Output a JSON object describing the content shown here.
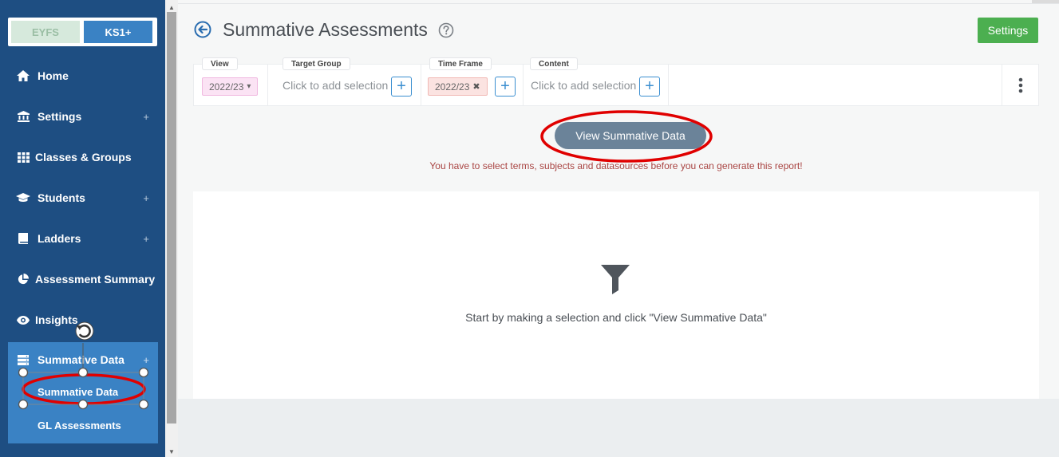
{
  "sidebar": {
    "stages": [
      {
        "label": "EYFS",
        "active": false
      },
      {
        "label": "KS1+",
        "active": true
      }
    ],
    "items": [
      {
        "label": "Home",
        "icon": "home-icon",
        "expandable": false
      },
      {
        "label": "Settings",
        "icon": "bank-icon",
        "expandable": true
      },
      {
        "label": "Classes & Groups",
        "icon": "grid-icon",
        "expandable": false
      },
      {
        "label": "Students",
        "icon": "graduation-cap-icon",
        "expandable": true
      },
      {
        "label": "Ladders",
        "icon": "book-icon",
        "expandable": true
      },
      {
        "label": "Assessment Summary",
        "icon": "pie-chart-icon",
        "expandable": false
      },
      {
        "label": "Insights",
        "icon": "eye-icon",
        "expandable": false
      },
      {
        "label": "Summative Data",
        "icon": "database-icon",
        "expandable": true,
        "active": true
      }
    ],
    "plus_glyph": "+",
    "sub_items": [
      {
        "label": "Summative Data"
      },
      {
        "label": "GL Assessments"
      }
    ]
  },
  "header": {
    "title": "Summative Assessments",
    "settings_label": "Settings"
  },
  "filters": {
    "view": {
      "label": "View",
      "value": "2022/23",
      "arrow": "▾"
    },
    "target_group": {
      "label": "Target Group",
      "placeholder": "Click to add selection"
    },
    "time_frame": {
      "label": "Time Frame",
      "value": "2022/23",
      "remove": "✖"
    },
    "content": {
      "label": "Content",
      "placeholder": "Click to add selection"
    },
    "add_glyph": "+"
  },
  "actions": {
    "view_button": "View Summative Data",
    "warning": "You have to select terms, subjects and datasources before you can generate this report!"
  },
  "results": {
    "empty_message": "Start by making a selection and click \"View Summative Data\""
  },
  "colors": {
    "sidebar": "#1e4e82",
    "active_group": "#3a82c4",
    "settings_button": "#4caf50",
    "view_button": "#6b8399",
    "warning": "#a94442",
    "annotation": "#e00000"
  }
}
